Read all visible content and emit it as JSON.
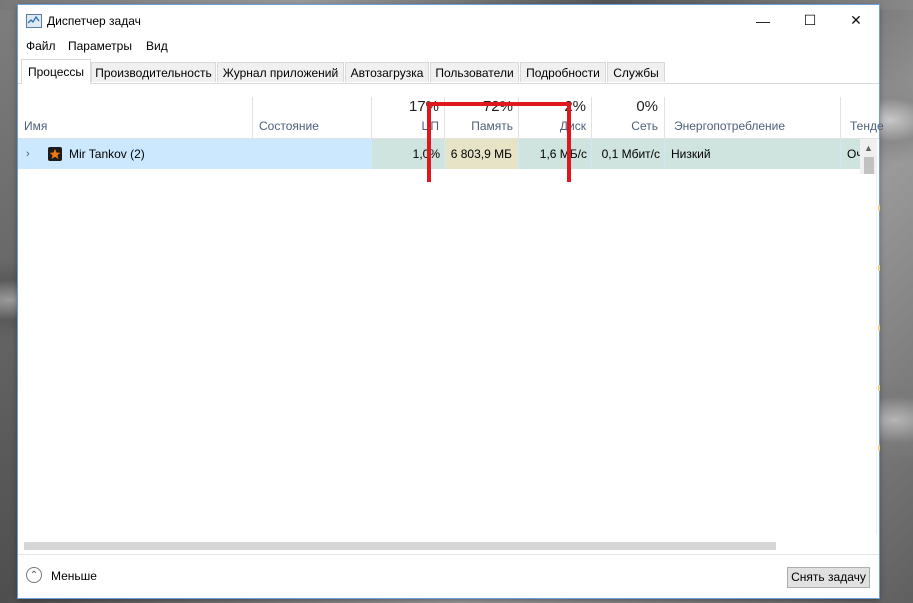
{
  "window": {
    "title": "Диспетчер задач",
    "controls": {
      "minimize": "—",
      "maximize": "☐",
      "close": "✕"
    }
  },
  "menu": [
    "Файл",
    "Параметры",
    "Вид"
  ],
  "tabs": [
    "Процессы",
    "Производительность",
    "Журнал приложений",
    "Автозагрузка",
    "Пользователи",
    "Подробности",
    "Службы"
  ],
  "columns": {
    "name": "Имя",
    "status": "Состояние",
    "cpu": {
      "pct": "17%",
      "label": "ЦП"
    },
    "memory": {
      "pct": "72%",
      "label": "Память"
    },
    "disk": {
      "pct": "2%",
      "label": "Диск"
    },
    "network": {
      "pct": "0%",
      "label": "Сеть"
    },
    "power": "Энергопотребление",
    "trend": "Тенде"
  },
  "process": {
    "name": "Mir Tankov (2)",
    "cpu": "1,0%",
    "memory": "6 803,9 МБ",
    "disk": "1,6 МБ/с",
    "network": "0,1 Мбит/с",
    "power": "Низкий",
    "trend": "Оч"
  },
  "footer": {
    "less_label": "Меньше",
    "end_task": "Снять задачу"
  },
  "colors": {
    "selection": "#cce8ff",
    "annotation": "#e0171c"
  }
}
